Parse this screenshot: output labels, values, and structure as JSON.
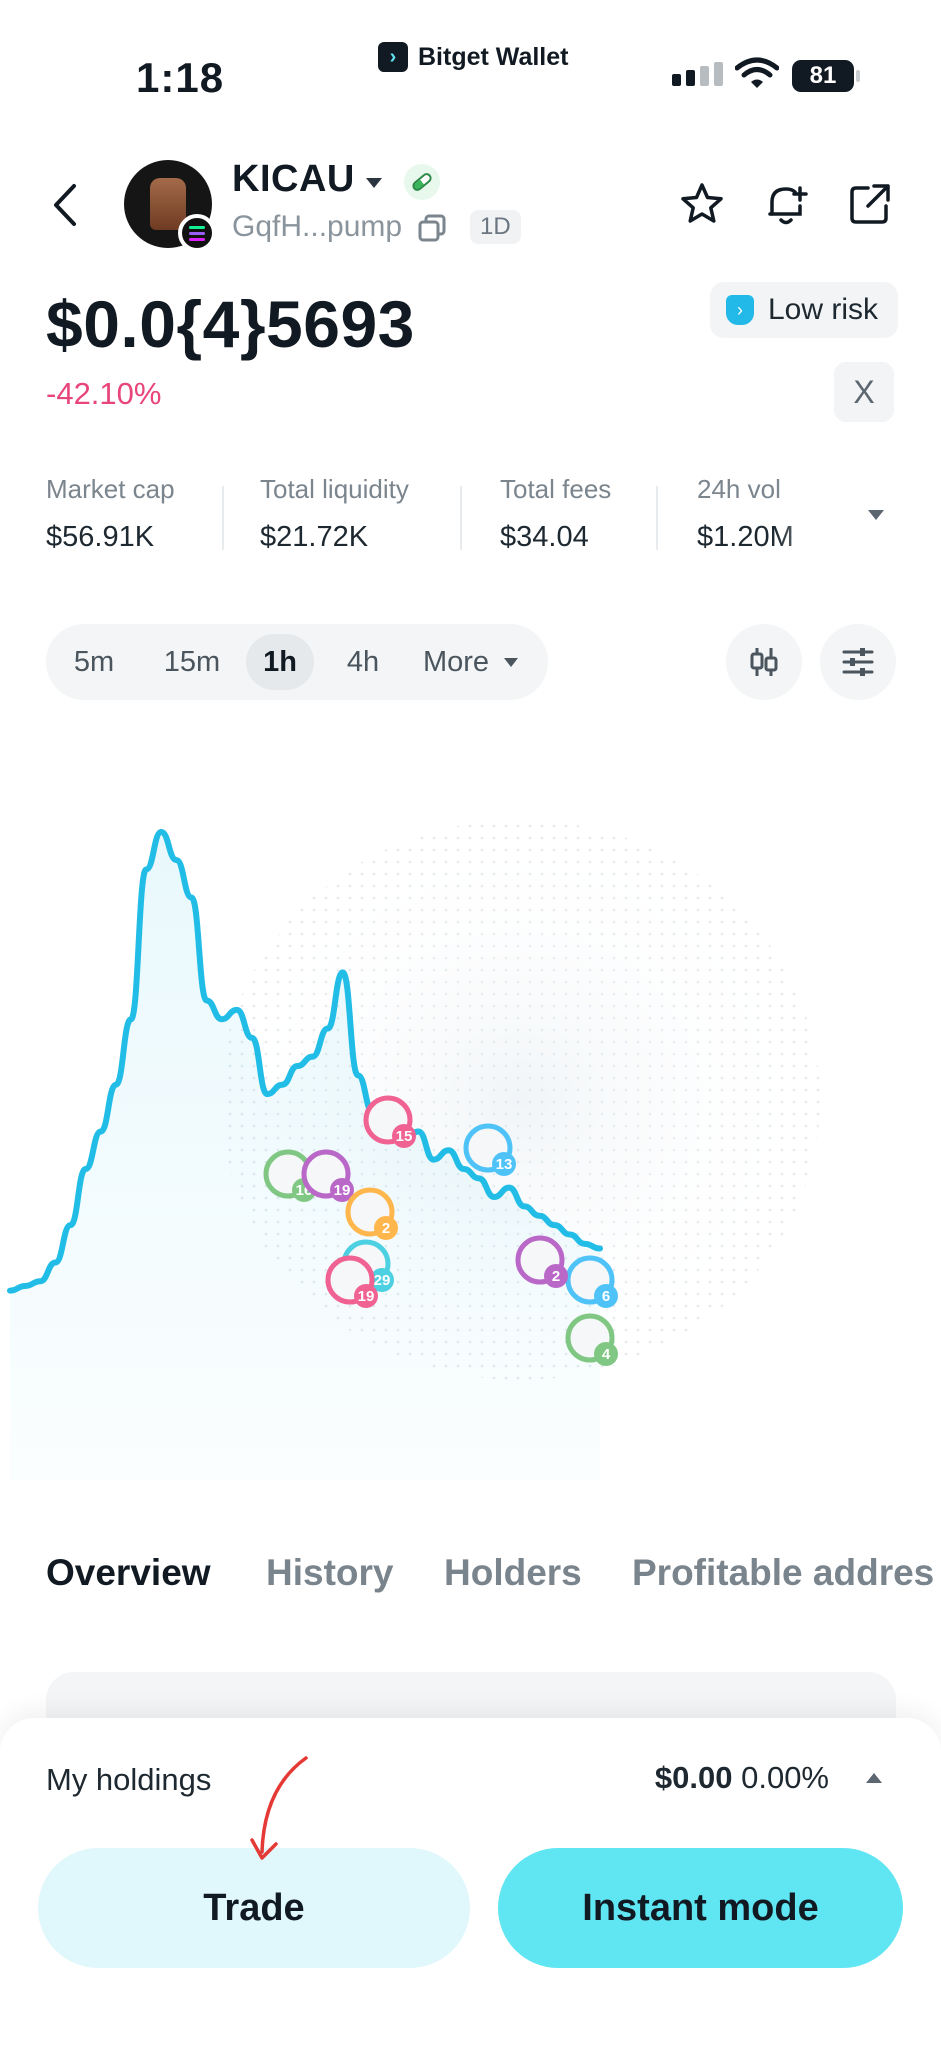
{
  "status_bar": {
    "time": "1:18",
    "app_name": "Bitget Wallet",
    "battery": "81"
  },
  "token": {
    "name": "KICAU",
    "address": "GqfH...pump",
    "age": "1D",
    "price": "$0.0{4}5693",
    "change": "-42.10%",
    "change_color": "#e8457a",
    "risk_label": "Low risk",
    "x_label": "X"
  },
  "stats": [
    {
      "label": "Market cap",
      "value": "$56.91K"
    },
    {
      "label": "Total liquidity",
      "value": "$21.72K"
    },
    {
      "label": "Total fees",
      "value": "$34.04"
    },
    {
      "label": "24h vol",
      "value": "$1.20M"
    }
  ],
  "timeframes": {
    "items": [
      "5m",
      "15m",
      "1h",
      "4h",
      "More"
    ],
    "selected": "1h"
  },
  "chart_data": {
    "type": "line",
    "color": "#22bde6",
    "x": [
      0,
      1,
      2,
      3,
      4,
      5,
      6,
      7,
      8,
      9,
      10,
      11,
      12,
      13,
      14,
      15,
      16,
      17,
      18,
      19,
      20,
      21,
      22,
      23,
      24,
      25,
      26,
      27,
      28,
      29,
      30,
      31,
      32,
      33,
      34,
      35,
      36,
      37,
      38,
      39
    ],
    "values": [
      2,
      3,
      4,
      8,
      16,
      28,
      36,
      46,
      60,
      92,
      100,
      94,
      86,
      64,
      60,
      62,
      56,
      44,
      46,
      50,
      52,
      58,
      70,
      48,
      40,
      38,
      34,
      36,
      30,
      32,
      28,
      26,
      22,
      24,
      20,
      18,
      16,
      14,
      12,
      11
    ],
    "trader_badges": [
      "15",
      "13",
      "16",
      "19",
      "2",
      "29",
      "19",
      "6",
      "4",
      "2"
    ],
    "title": "",
    "xlabel": "",
    "ylabel": ""
  },
  "tabs": [
    "Overview",
    "History",
    "Holders",
    "Profitable addres"
  ],
  "holdings": {
    "label": "My holdings",
    "value": "$0.00",
    "percent": "0.00%"
  },
  "buttons": {
    "trade": "Trade",
    "instant": "Instant mode"
  },
  "colors": {
    "accent": "#5fe6f2",
    "accent_light": "#e0f8fb",
    "negative": "#e8457a"
  }
}
